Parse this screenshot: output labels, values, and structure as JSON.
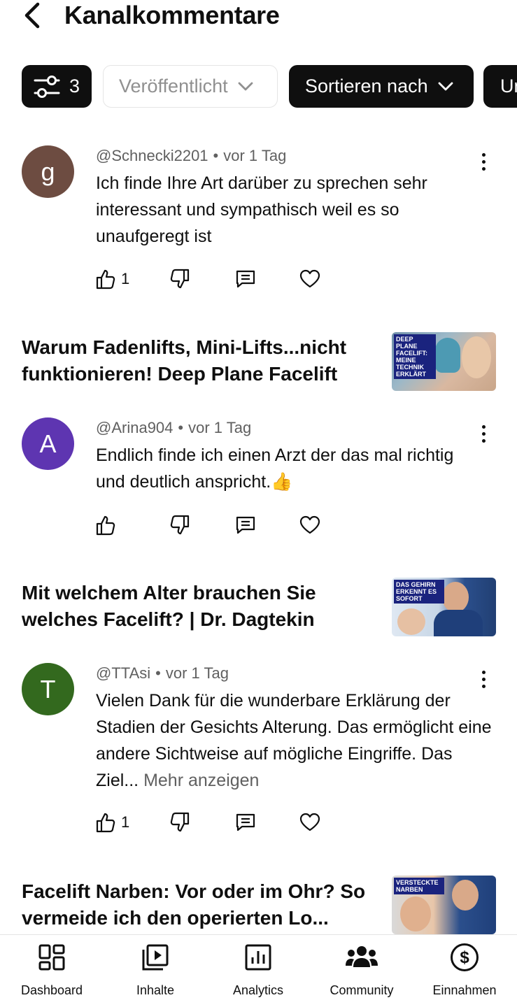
{
  "header": {
    "title": "Kanalkommentare",
    "back_icon": "chevron-left-icon"
  },
  "chips": {
    "filter_count": "3",
    "published_label": "Veröffentlicht",
    "sort_label": "Sortieren nach",
    "more_label": "Un"
  },
  "comments": [
    {
      "avatar_letter": "g",
      "avatar_color": "#6d4c41",
      "author": "@Schnecki2201",
      "time": "vor 1 Tag",
      "text": "Ich finde Ihre Art darüber zu sprechen sehr interessant und sympathisch weil es so unaufgeregt ist",
      "likes": "1"
    },
    {
      "avatar_letter": "A",
      "avatar_color": "#5e35b1",
      "author": "@Arina904",
      "time": "vor 1 Tag",
      "text": "Endlich finde ich einen Arzt der das mal richtig und deutlich anspricht.👍",
      "likes": ""
    },
    {
      "avatar_letter": "T",
      "avatar_color": "#33691e",
      "author": "@TTAsi",
      "time": "vor 1 Tag",
      "text": "Vielen Dank für die wunderbare Erklärung der Stadien der Gesichts Alterung. Das ermöglicht eine andere Sichtweise auf mögliche Eingriffe. Das Ziel...",
      "more": "Mehr anzeigen",
      "likes": "1"
    }
  ],
  "videos": [
    {
      "title": "Warum Fadenlifts, Mini-Lifts...nicht funktionieren! Deep Plane Facelift",
      "thumb_text": "DEEP PLANE FACELIFT: MEINE TECHNIK ERKLÄRT"
    },
    {
      "title": "Mit welchem Alter brauchen Sie welches Facelift? | Dr. Dagtekin",
      "thumb_text": "DAS GEHIRN ERKENNT ES SOFORT"
    },
    {
      "title": "Facelift Narben: Vor oder im Ohr? So vermeide ich den operierten Lo...",
      "thumb_text": "VERSTECKTE NARBEN"
    }
  ],
  "nav": {
    "dashboard": "Dashboard",
    "content": "Inhalte",
    "analytics": "Analytics",
    "community": "Community",
    "earnings": "Einnahmen"
  }
}
